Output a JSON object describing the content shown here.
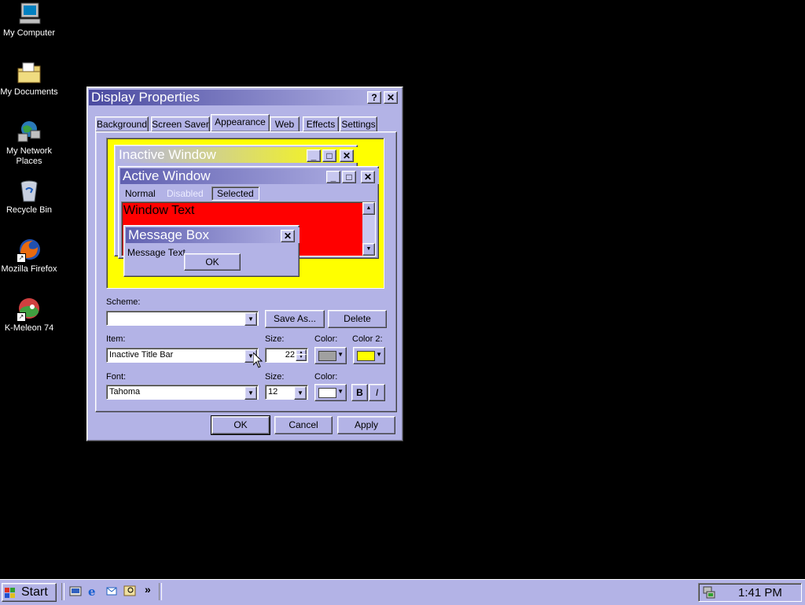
{
  "desktop": {
    "icons": [
      {
        "label": "My Computer",
        "icon": "computer-icon"
      },
      {
        "label": "My Documents",
        "icon": "folder-documents-icon"
      },
      {
        "label": "My Network Places",
        "icon": "network-places-icon"
      },
      {
        "label": "Recycle Bin",
        "icon": "recycle-bin-icon"
      },
      {
        "label": "Mozilla Firefox",
        "icon": "firefox-icon"
      },
      {
        "label": "K-Meleon 74",
        "icon": "kmeleon-icon"
      }
    ]
  },
  "dialog": {
    "title": "Display Properties",
    "help_glyph": "?",
    "close_glyph": "✕",
    "tabs": [
      "Background",
      "Screen Saver",
      "Appearance",
      "Web",
      "Effects",
      "Settings"
    ],
    "active_tab": "Appearance",
    "preview": {
      "inactive_title": "Inactive Window",
      "active_title": "Active Window",
      "menu_normal": "Normal",
      "menu_disabled": "Disabled",
      "menu_selected": "Selected",
      "window_text": "Window Text",
      "message_title": "Message Box",
      "message_text": "Message Text",
      "ok_label": "OK"
    },
    "scheme_label": "Scheme:",
    "scheme_value": "",
    "save_as_label": "Save As...",
    "delete_label": "Delete",
    "item_label": "Item:",
    "item_value": "Inactive Title Bar",
    "item_size_label": "Size:",
    "item_size_value": "22",
    "color_label": "Color:",
    "color2_label": "Color 2:",
    "font_label": "Font:",
    "font_value": "Tahoma",
    "font_size_label": "Size:",
    "font_size_value": "12",
    "font_color_label": "Color:",
    "bold_label": "B",
    "italic_label": "I",
    "ok_label": "OK",
    "cancel_label": "Cancel",
    "apply_label": "Apply"
  },
  "taskbar": {
    "start_label": "Start",
    "quick_launch": [
      "show-desktop-icon",
      "internet-explorer-icon",
      "outlook-express-icon",
      "search-icon"
    ],
    "chevron": "»",
    "clock": "1:41 PM"
  },
  "colors": {
    "face": "#b3b3e6",
    "title_active_start": "#3a3a8c",
    "title_inactive_end": "#ffff00",
    "preview_bg": "#ffff00",
    "window_bg": "#ff0000",
    "color_swatch": "#a0a0a0",
    "color2_swatch": "#ffff00",
    "font_color_swatch": "#ffffff"
  }
}
